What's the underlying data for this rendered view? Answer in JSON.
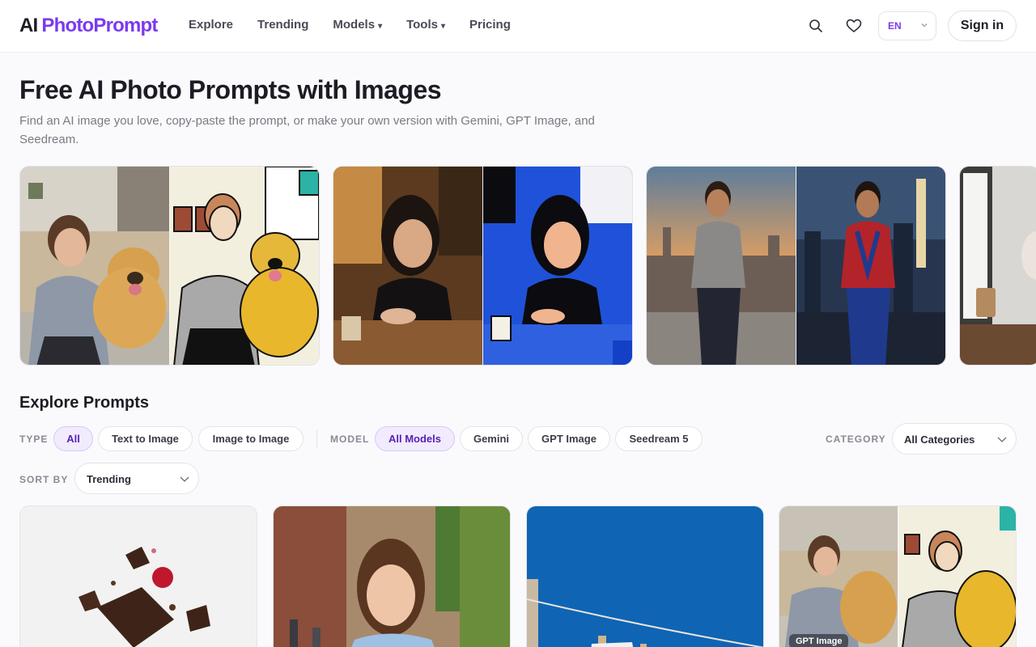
{
  "header": {
    "logo_ai": "AI",
    "logo_brand": "PhotoPrompt",
    "nav": [
      {
        "label": "Explore",
        "caret": ""
      },
      {
        "label": "Trending",
        "caret": ""
      },
      {
        "label": "Models",
        "caret": "▾"
      },
      {
        "label": "Tools",
        "caret": "▾"
      },
      {
        "label": "Pricing",
        "caret": ""
      }
    ],
    "search_icon": "search-icon",
    "favorites_icon": "heart-icon",
    "language": "EN",
    "sign_in": "Sign in"
  },
  "hero": {
    "title": "Free AI Photo Prompts with Images",
    "subtitle": "Find an AI image you love, copy-paste the prompt, or make your own version with Gemini, GPT Image, and Seedream."
  },
  "explore": {
    "title": "Explore Prompts",
    "type_label": "TYPE",
    "type_options": [
      "All",
      "Text to Image",
      "Image to Image"
    ],
    "model_label": "MODEL",
    "model_options": [
      "All Models",
      "Gemini",
      "GPT Image",
      "Seedream 5"
    ],
    "category_label": "CATEGORY",
    "category_value": "All Categories",
    "sort_label": "SORT BY",
    "sort_value": "Trending"
  },
  "grid": {
    "card4_badge": "GPT Image"
  },
  "colors": {
    "accent": "#7c3aed",
    "chip_active_bg": "#f1ebfd",
    "text_primary": "#1c1c24",
    "text_muted": "#7a7a86"
  }
}
